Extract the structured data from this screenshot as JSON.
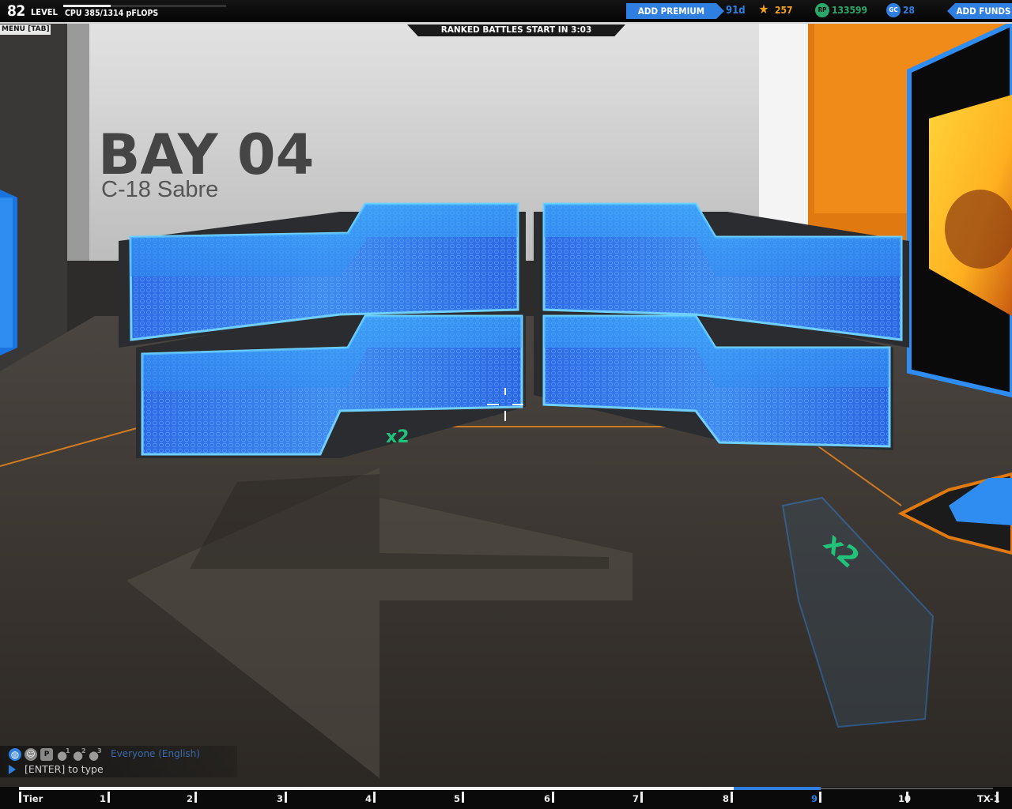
{
  "hud": {
    "level": "82",
    "level_label": "LEVEL",
    "cpu_text": "CPU 385/1314 pFLOPS",
    "cpu_usage_fraction": 0.293,
    "add_premium": "ADD PREMIUM",
    "premium_days": "91d",
    "stars": "257",
    "rp": "133599",
    "rp_icon": "RP",
    "gc": "28",
    "gc_icon": "GC",
    "add_funds": "ADD FUNDS",
    "menu_tab": "MENU [TAB]",
    "ranked_notice": "RANKED BATTLES START IN 3:03"
  },
  "bay": {
    "title": "BAY 04",
    "robot_name": "C-18 Sabre",
    "floor_marker_1": "x2",
    "floor_marker_2": "x2"
  },
  "chat": {
    "channel": "Everyone (English)",
    "input_placeholder": "[ENTER] to type",
    "icons": [
      "globe-icon",
      "person-icon",
      "p-icon",
      "party-1-icon",
      "party-2-icon",
      "party-3-icon"
    ],
    "icon_labels": {
      "p": "P",
      "one": "1",
      "two": "2",
      "three": "3"
    }
  },
  "tiers": {
    "labels": [
      "Tier",
      "1",
      "2",
      "3",
      "4",
      "5",
      "6",
      "7",
      "8",
      "9",
      "10",
      "TX-1"
    ],
    "current": "9"
  },
  "colors": {
    "accent": "#2f7fe0",
    "star": "#f0a020",
    "rp": "#2aa86a",
    "gc": "#2f7fe0"
  }
}
